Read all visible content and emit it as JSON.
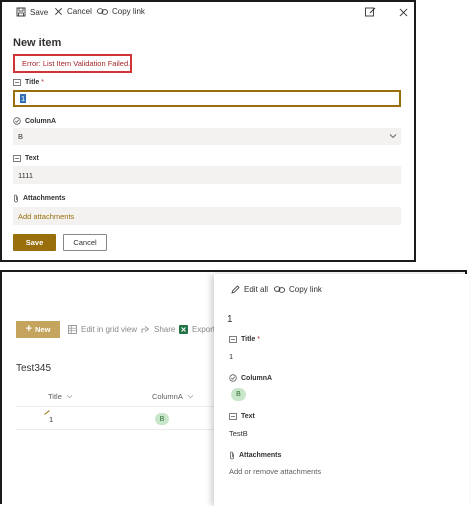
{
  "top": {
    "toolbar": {
      "save": "Save",
      "cancel": "Cancel",
      "copy_link": "Copy link"
    },
    "title": "New item",
    "error": "Error: List Item Validation Failed.",
    "fields": {
      "title": {
        "label": "Title",
        "required": "*",
        "value": "1"
      },
      "columnA": {
        "label": "ColumnA",
        "value": "B"
      },
      "text": {
        "label": "Text",
        "value": "1111"
      },
      "attachments": {
        "label": "Attachments",
        "link": "Add attachments"
      }
    },
    "buttons": {
      "save": "Save",
      "cancel": "Cancel"
    },
    "colors": {
      "accent": "#986f0b",
      "error": "#a4262c"
    }
  },
  "bottom": {
    "commandbar": {
      "new": "New",
      "edit_grid": "Edit in grid view",
      "share": "Share",
      "export": "Export"
    },
    "list_title": "Test345",
    "columns": [
      "Title",
      "ColumnA"
    ],
    "rows": [
      {
        "title": "1",
        "columnA": "B"
      }
    ],
    "pane": {
      "toolbar": {
        "edit_all": "Edit all",
        "copy_link": "Copy link"
      },
      "title": "1",
      "fields": {
        "title": {
          "label": "Title",
          "required": "*",
          "value": "1"
        },
        "columnA": {
          "label": "ColumnA",
          "value": "B"
        },
        "text": {
          "label": "Text",
          "value": "TestB"
        },
        "attachments": {
          "label": "Attachments",
          "value": "Add or remove attachments"
        }
      }
    }
  }
}
